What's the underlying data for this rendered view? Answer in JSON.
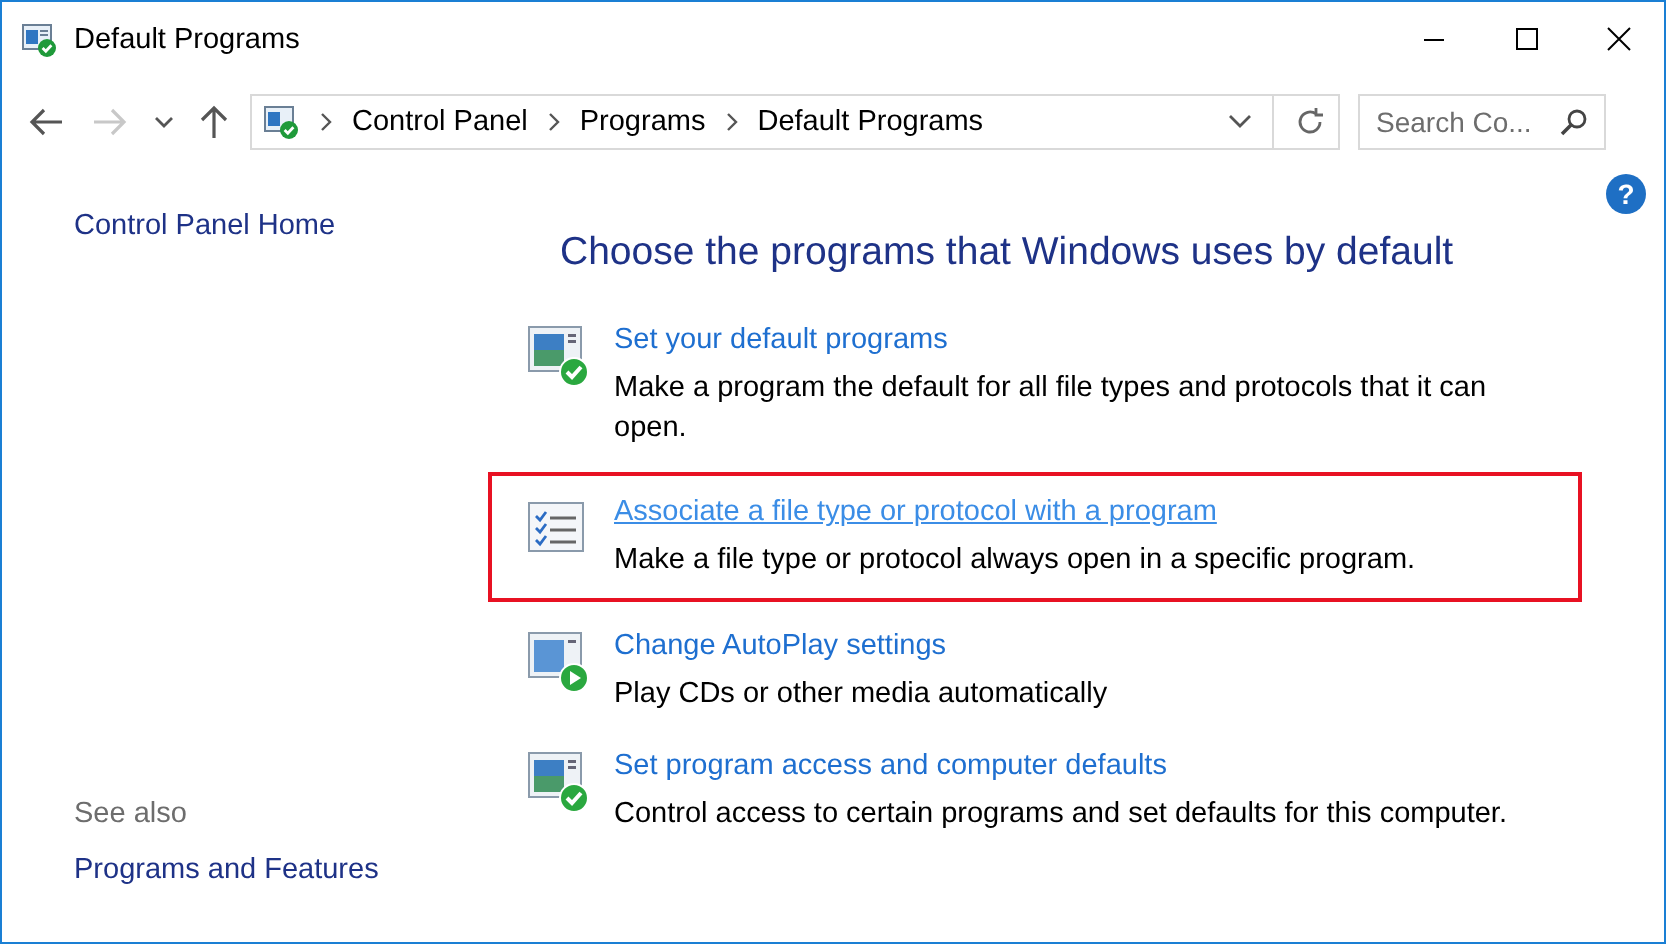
{
  "window": {
    "title": "Default Programs"
  },
  "navigation": {
    "back_disabled": false,
    "forward_disabled": true,
    "breadcrumb": [
      "Control Panel",
      "Programs",
      "Default Programs"
    ],
    "search": {
      "placeholder": "Search Co..."
    }
  },
  "help": "?",
  "sidebar": {
    "home": "Control Panel Home",
    "see_also_title": "See also",
    "see_also": [
      "Programs and Features"
    ]
  },
  "main": {
    "heading": "Choose the programs that Windows uses by default",
    "items": [
      {
        "kind": "check",
        "title": "Set your default programs",
        "description": "Make a program the default for all file types and protocols that it can open.",
        "highlighted": false
      },
      {
        "kind": "list",
        "title": "Associate a file type or protocol with a program",
        "description": "Make a file type or protocol always open in a specific program.",
        "highlighted": true
      },
      {
        "kind": "play",
        "title": "Change AutoPlay settings",
        "description": "Play CDs or other media automatically",
        "highlighted": false
      },
      {
        "kind": "check",
        "title": "Set program access and computer defaults",
        "description": "Control access to certain programs and set defaults for this computer.",
        "highlighted": false
      }
    ]
  }
}
